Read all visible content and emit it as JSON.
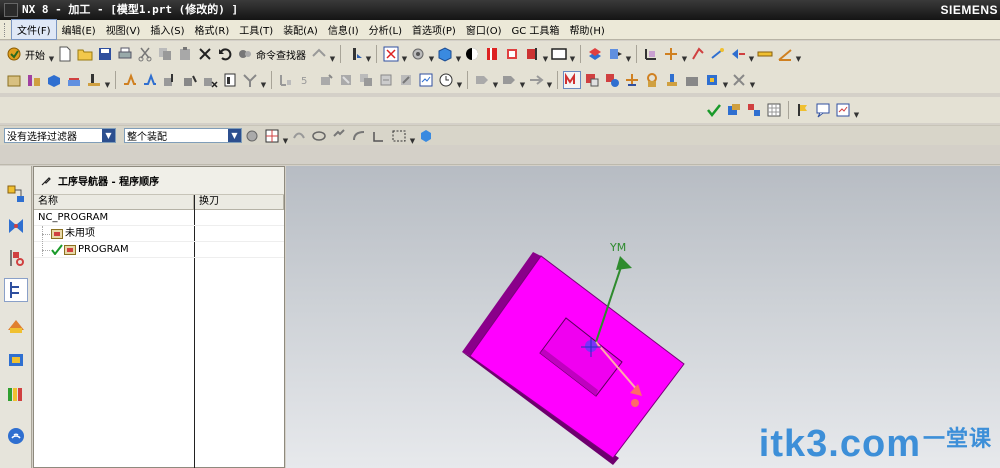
{
  "window": {
    "title": "NX 8 - 加工 - [模型1.prt  (修改的) ]",
    "brand": "SIEMENS"
  },
  "menu": [
    "文件(F)",
    "编辑(E)",
    "视图(V)",
    "插入(S)",
    "格式(R)",
    "工具(T)",
    "装配(A)",
    "信息(I)",
    "分析(L)",
    "首选项(P)",
    "窗口(O)",
    "GC 工具箱",
    "帮助(H)"
  ],
  "toolbar": {
    "start_label": "开始",
    "command_finder_label": "命令查找器"
  },
  "selection": {
    "filter_value": "没有选择过滤器",
    "scope_value": "整个装配"
  },
  "navigator": {
    "title": "工序导航器 - 程序顺序",
    "columns": [
      "名称",
      "换刀"
    ],
    "rows": [
      {
        "label": "NC_PROGRAM"
      },
      {
        "label": "未用项"
      },
      {
        "label": "PROGRAM"
      }
    ]
  },
  "viewport": {
    "axis_y_label": "YM"
  },
  "watermark": {
    "text": "itk3",
    "dot": ".",
    "com": "com",
    "zh": "一堂课"
  },
  "colors": {
    "part_face": "#ff00ff",
    "part_edge": "#7a007a",
    "axis_y": "#2e8b2e",
    "axis_x": "#ff6a6a"
  }
}
